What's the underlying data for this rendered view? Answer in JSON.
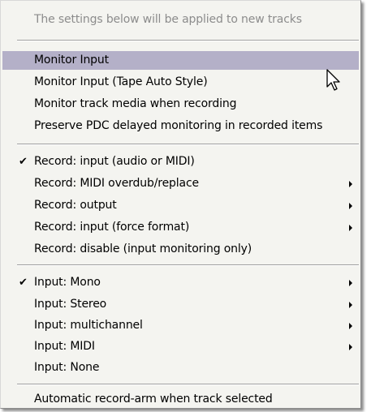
{
  "menu": {
    "header": "The settings below will be applied to new tracks",
    "monitor_group": [
      {
        "label": "Monitor Input",
        "checked": false,
        "submenu": false,
        "highlighted": true
      },
      {
        "label": "Monitor Input (Tape Auto Style)",
        "checked": false,
        "submenu": false
      },
      {
        "label": "Monitor track media when recording",
        "checked": false,
        "submenu": false
      },
      {
        "label": "Preserve PDC delayed monitoring in recorded items",
        "checked": false,
        "submenu": false
      }
    ],
    "record_group": [
      {
        "label": "Record: input (audio or MIDI)",
        "checked": true,
        "submenu": false
      },
      {
        "label": "Record: MIDI overdub/replace",
        "checked": false,
        "submenu": true
      },
      {
        "label": "Record: output",
        "checked": false,
        "submenu": true
      },
      {
        "label": "Record: input (force format)",
        "checked": false,
        "submenu": true
      },
      {
        "label": "Record: disable (input monitoring only)",
        "checked": false,
        "submenu": false
      }
    ],
    "input_group": [
      {
        "label": "Input: Mono",
        "checked": true,
        "submenu": true
      },
      {
        "label": "Input: Stereo",
        "checked": false,
        "submenu": true
      },
      {
        "label": "Input: multichannel",
        "checked": false,
        "submenu": true
      },
      {
        "label": "Input: MIDI",
        "checked": false,
        "submenu": true
      },
      {
        "label": "Input: None",
        "checked": false,
        "submenu": false
      }
    ],
    "footer_item": "Automatic record-arm when track selected",
    "check_glyph": "✔",
    "colors": {
      "background": "#f4f4f0",
      "highlight": "#b4b0c8",
      "disabled_text": "#8c8c8c"
    }
  },
  "cursor_icon": "mouse-pointer-icon"
}
